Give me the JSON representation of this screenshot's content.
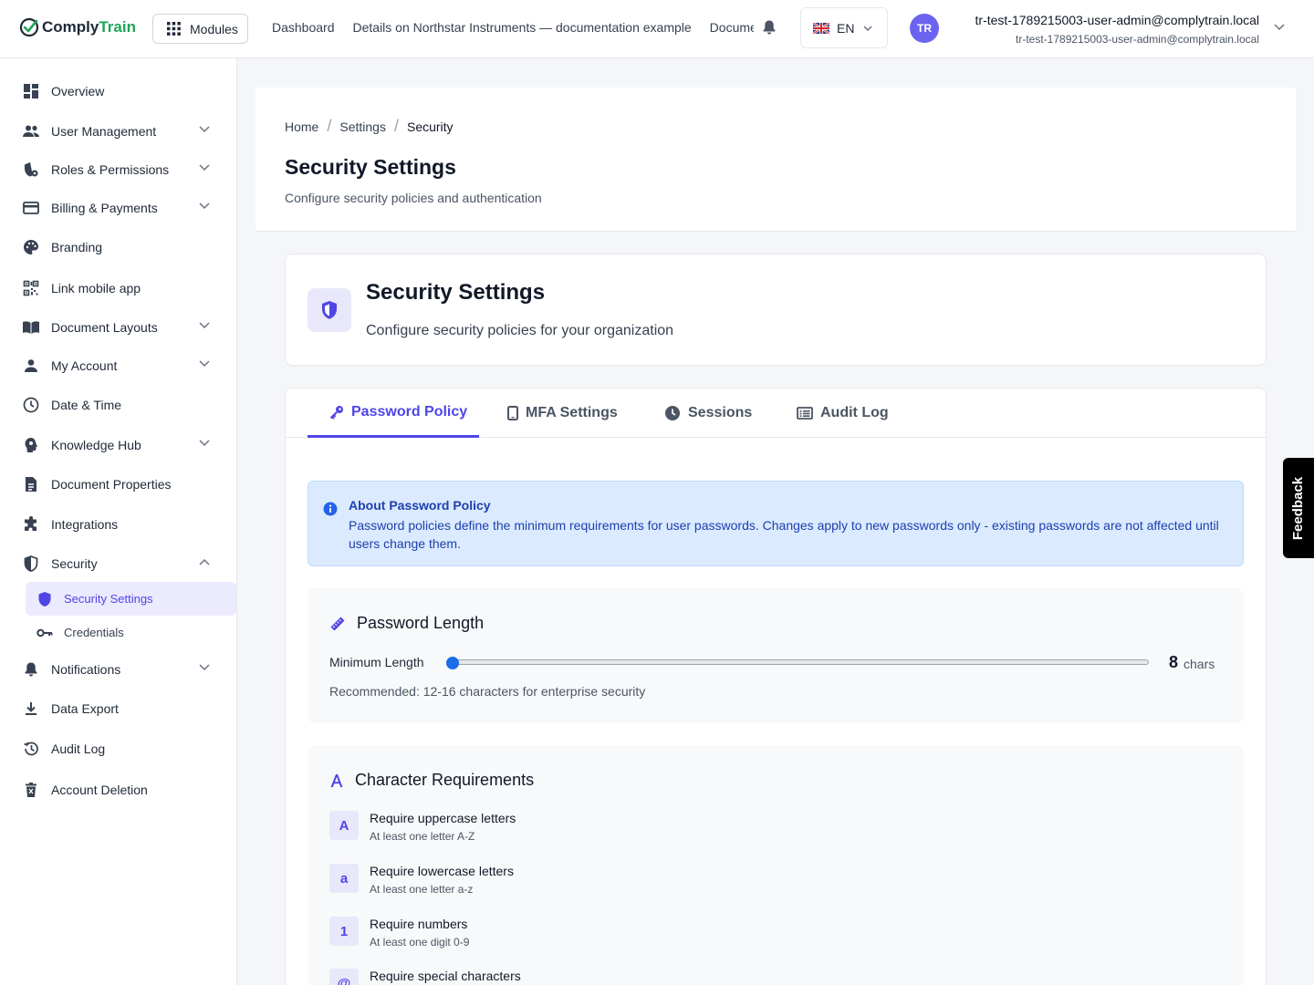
{
  "brand": {
    "name_part1": "Comply",
    "name_part2": "Train"
  },
  "topbar": {
    "modules_label": "Modules",
    "nav": [
      "Dashboard",
      "Details on Northstar Instruments — documentation example",
      "Documents"
    ],
    "language": "EN",
    "avatar_initials": "TR",
    "user_name": "tr-test-1789215003-user-admin@complytrain.local",
    "user_email": "tr-test-1789215003-user-admin@complytrain.local"
  },
  "sidebar": {
    "items": [
      {
        "label": "Overview"
      },
      {
        "label": "User Management"
      },
      {
        "label": "Roles & Permissions"
      },
      {
        "label": "Billing & Payments"
      },
      {
        "label": "Branding"
      },
      {
        "label": "Link mobile app"
      },
      {
        "label": "Document Layouts"
      },
      {
        "label": "My Account"
      },
      {
        "label": "Date & Time"
      },
      {
        "label": "Knowledge Hub"
      },
      {
        "label": "Document Properties"
      },
      {
        "label": "Integrations"
      },
      {
        "label": "Security"
      },
      {
        "label": "Notifications"
      },
      {
        "label": "Data Export"
      },
      {
        "label": "Audit Log"
      },
      {
        "label": "Account Deletion"
      }
    ],
    "security_sub": [
      {
        "label": "Security Settings"
      },
      {
        "label": "Credentials"
      }
    ]
  },
  "breadcrumb": [
    "Home",
    "Settings",
    "Security"
  ],
  "page": {
    "title": "Security Settings",
    "subtitle": "Configure security policies and authentication"
  },
  "hero": {
    "title": "Security Settings",
    "subtitle": "Configure security policies for your organization"
  },
  "tabs": [
    {
      "label": "Password Policy"
    },
    {
      "label": "MFA Settings"
    },
    {
      "label": "Sessions"
    },
    {
      "label": "Audit Log"
    }
  ],
  "info": {
    "title": "About Password Policy",
    "text": "Password policies define the minimum requirements for user passwords. Changes apply to new passwords only - existing passwords are not affected until users change them."
  },
  "password_length": {
    "title": "Password Length",
    "min_label": "Minimum Length",
    "value": "8",
    "unit": "chars",
    "slider_fraction": 0,
    "recommendation": "Recommended: 12-16 characters for enterprise security"
  },
  "char_requirements": {
    "title": "Character Requirements",
    "items": [
      {
        "badge": "A",
        "title": "Require uppercase letters",
        "desc": "At least one letter A-Z"
      },
      {
        "badge": "a",
        "title": "Require lowercase letters",
        "desc": "At least one letter a-z"
      },
      {
        "badge": "1",
        "title": "Require numbers",
        "desc": "At least one digit 0-9"
      },
      {
        "badge": "@",
        "title": "Require special characters",
        "desc": ""
      }
    ]
  },
  "feedback_label": "Feedback",
  "colors": {
    "accent": "#4f46e5",
    "info_bg": "#dbeafe",
    "brand_green": "#22a35a",
    "slider": "#1a6fe8"
  }
}
